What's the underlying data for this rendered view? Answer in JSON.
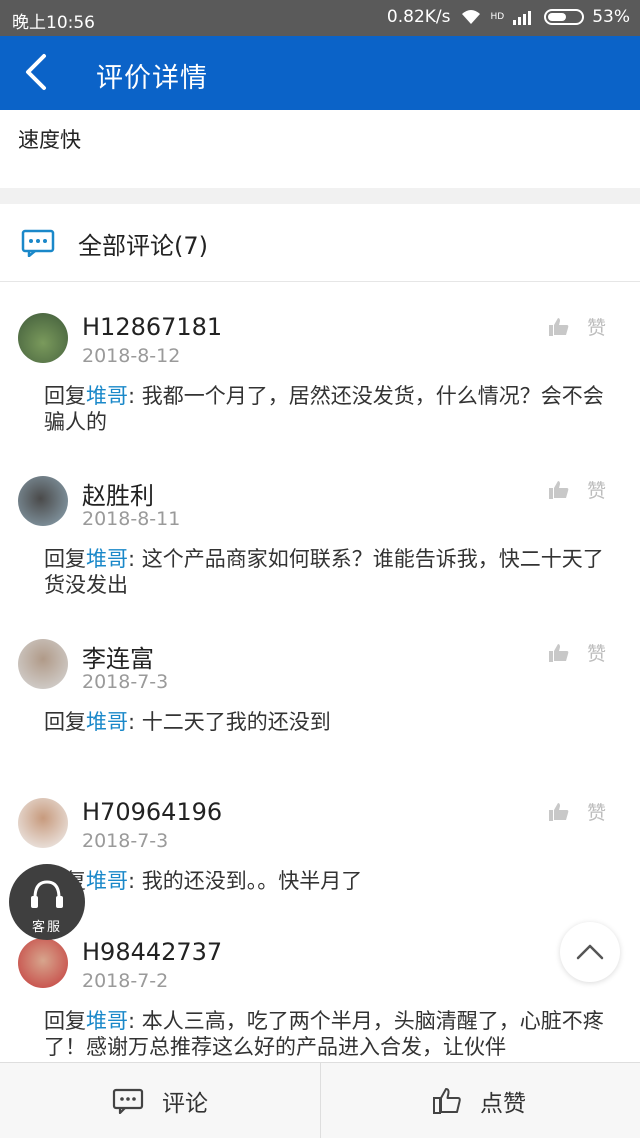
{
  "status_bar": {
    "time": "晚上10:56",
    "speed": "0.82K/s",
    "network": "HD",
    "battery": "53%"
  },
  "header": {
    "title": "评价详情",
    "background": "#0b63c8"
  },
  "summary": {
    "text": "速度快"
  },
  "comments_section": {
    "title": "全部评论(7)",
    "reply_prefix": "回复",
    "reply_to": "堆哥",
    "colon": ": ",
    "like_label": "赞",
    "items": [
      {
        "username": "H12867181",
        "date": "2018-8-12",
        "text": "我都一个月了，居然还没发货，什么情况？会不会骗人的"
      },
      {
        "username": "赵胜利",
        "date": "2018-8-11",
        "text": "这个产品商家如何联系？谁能告诉我，快二十天了货没发出"
      },
      {
        "username": "李连富",
        "date": "2018-7-3",
        "text": "十二天了我的还没到"
      },
      {
        "username": "H70964196",
        "date": "2018-7-3",
        "text": "我的还没到。。快半月了"
      },
      {
        "username": "H98442737",
        "date": "2018-7-2",
        "text": "本人三高，吃了两个半月，头脑清醒了，心脏不疼了！感谢万总推荐这么好的产品进入合发，让伙伴"
      }
    ]
  },
  "floating": {
    "service_label": "客服"
  },
  "bottom_bar": {
    "comment_label": "评论",
    "like_label": "点赞"
  },
  "colors": {
    "accent": "#0b63c8",
    "reply_link": "#1a88c9",
    "muted": "#9a9a9a"
  }
}
